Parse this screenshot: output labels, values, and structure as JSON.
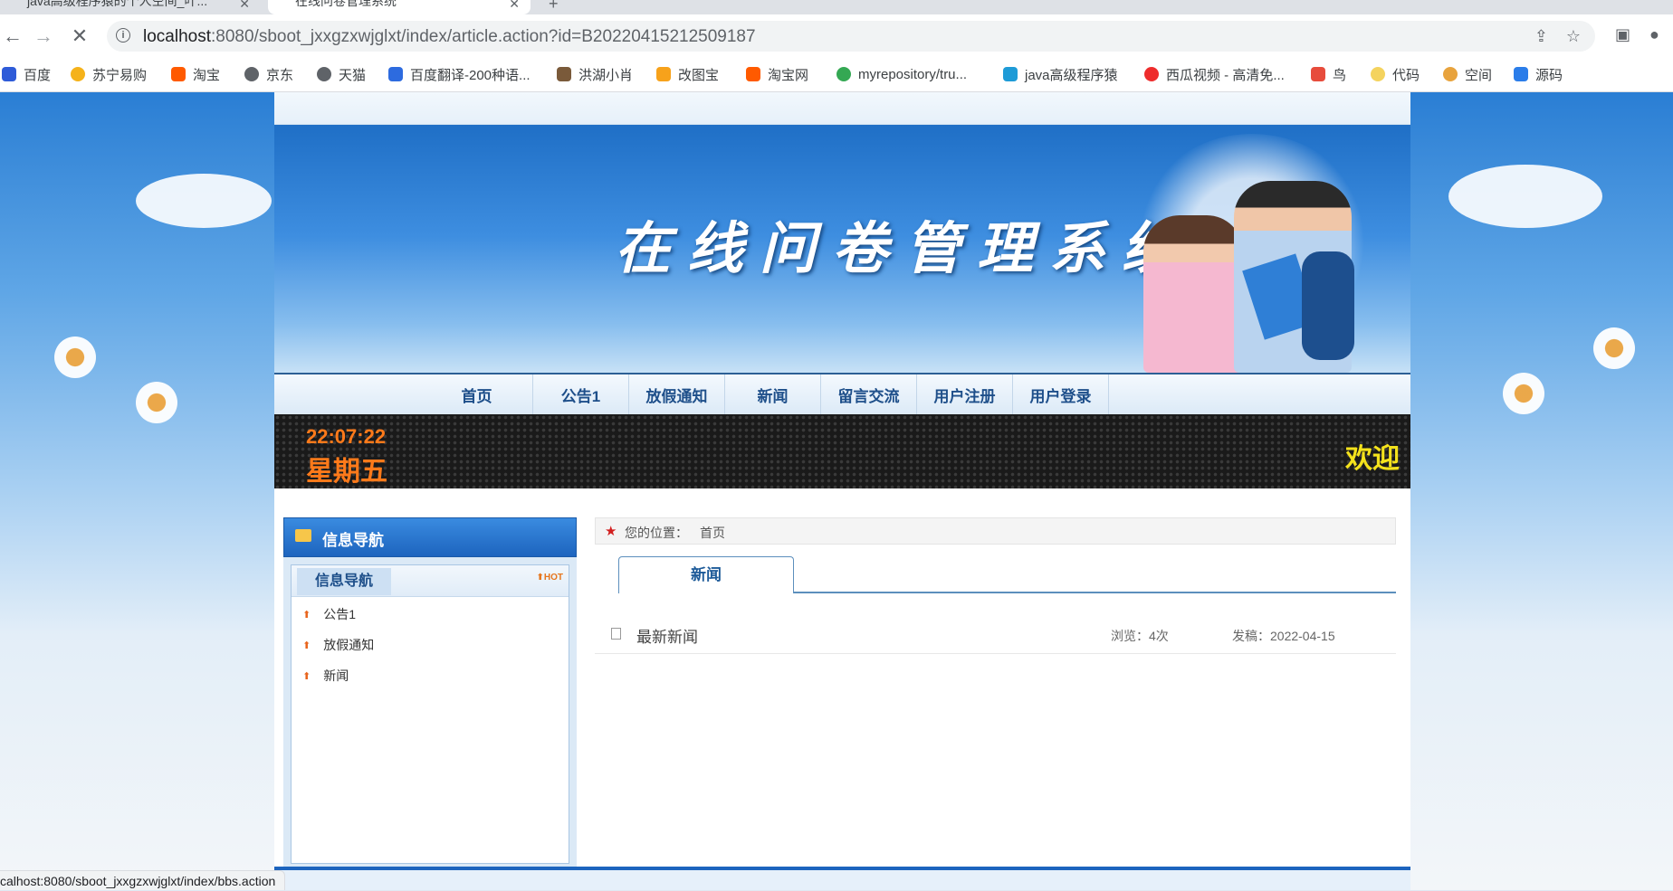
{
  "browser": {
    "tabs": [
      {
        "title": "java高级程序猿的个人空间_叶..."
      },
      {
        "title": "在线问卷管理系统"
      }
    ],
    "newtab_label": "+",
    "url_host": "localhost",
    "url_rest": ":8080/sboot_jxxgzxwjglxt/index/article.action?id=B20220415212509187",
    "bookmarks": [
      {
        "label": "百度",
        "color": "#2e5bd8"
      },
      {
        "label": "苏宁易购",
        "color": "#f5b21a"
      },
      {
        "label": "淘宝",
        "color": "#ff5a00"
      },
      {
        "label": "京东",
        "color": "#5f6368"
      },
      {
        "label": "天猫",
        "color": "#5f6368"
      },
      {
        "label": "百度翻译-200种语...",
        "color": "#2d6bdf"
      },
      {
        "label": "洪湖小肖",
        "color": "#7a5a3a"
      },
      {
        "label": "改图宝",
        "color": "#f7a21b"
      },
      {
        "label": "淘宝网",
        "color": "#ff5a00"
      },
      {
        "label": "myrepository/tru...",
        "color": "#34a853"
      },
      {
        "label": "java高级程序猿",
        "color": "#1e9bd7"
      },
      {
        "label": "西瓜视频 - 高清免...",
        "color": "#ee2c2c"
      },
      {
        "label": "鸟",
        "color": "#e74c3c"
      },
      {
        "label": "代码",
        "color": "#f4d35e"
      },
      {
        "label": "空间",
        "color": "#e8a33d"
      },
      {
        "label": "源码",
        "color": "#2b7de9"
      }
    ],
    "status_text": "calhost:8080/sboot_jxxgzxwjglxt/index/bbs.action"
  },
  "site": {
    "banner_title": "在线问卷管理系统",
    "menu": [
      "首页",
      "公告1",
      "放假通知",
      "新闻",
      "留言交流",
      "用户注册",
      "用户登录"
    ],
    "clock_time": "22:07:22",
    "clock_weekday": "星期五",
    "welcome": "欢迎"
  },
  "sidebar": {
    "header": "信息导航",
    "tab_label": "信息导航",
    "hot_badge": "HOT",
    "items": [
      "公告1",
      "放假通知",
      "新闻"
    ]
  },
  "content": {
    "crumb_label": "您的位置：",
    "crumb_value": "首页",
    "tab": "新闻",
    "articles": [
      {
        "title": "最新新闻",
        "views": "浏览：4次",
        "date": "发稿：2022-04-15"
      }
    ]
  },
  "colors": {
    "menu_text": "#1e4f8a",
    "clock_orange": "#ff7a1a",
    "welcome_yellow": "#f4e21c",
    "accent_blue": "#1d64be"
  }
}
